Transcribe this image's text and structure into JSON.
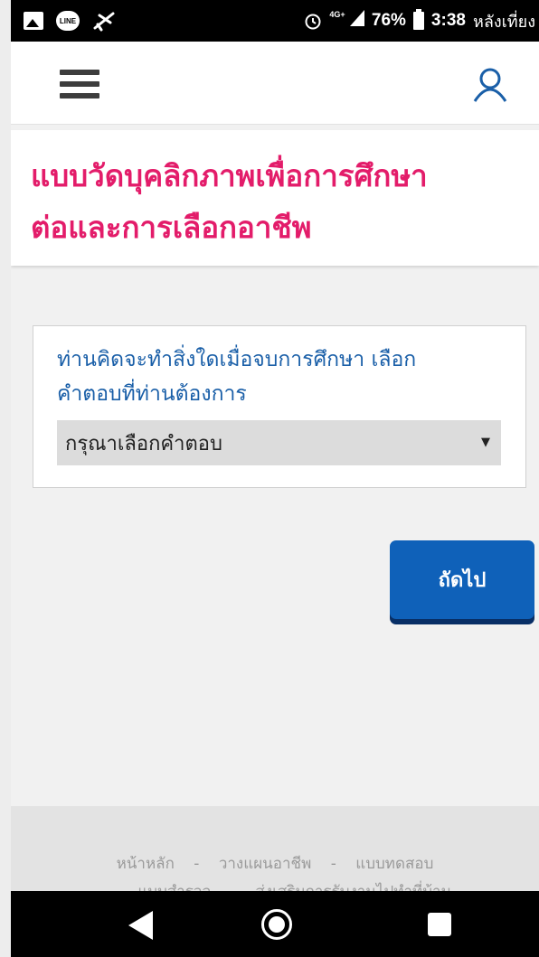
{
  "status_bar": {
    "net": "4G+",
    "battery": "76%",
    "time": "3:38",
    "time_suffix": "หลังเที่ยง",
    "line_label": "LINE"
  },
  "header": {
    "icons": [
      "menu-icon",
      "user-icon"
    ]
  },
  "title": {
    "line1": "แบบวัดบุคลิกภาพเพื่อการศึกษา",
    "line2": "ต่อและการเลือกอาชีพ"
  },
  "question": {
    "line1": "ท่านคิดจะทำสิ่งใดเมื่อจบการศึกษา เลือก",
    "line2": "คำตอบที่ท่านต้องการ",
    "select_value": "กรุณาเลือกคำตอบ"
  },
  "next_button": "ถัดไป",
  "footer": {
    "row1": [
      "หน้าหลัก",
      "วางแผนอาชีพ",
      "แบบทดสอบ"
    ],
    "row2": [
      "แบบสำรวจ",
      "ส่งเสริมการรับงานไปทำที่บ้าน"
    ],
    "separator": "-"
  },
  "colors": {
    "title": "#e31c6a",
    "question": "#1a5fa8",
    "button": "#0f61b9"
  }
}
